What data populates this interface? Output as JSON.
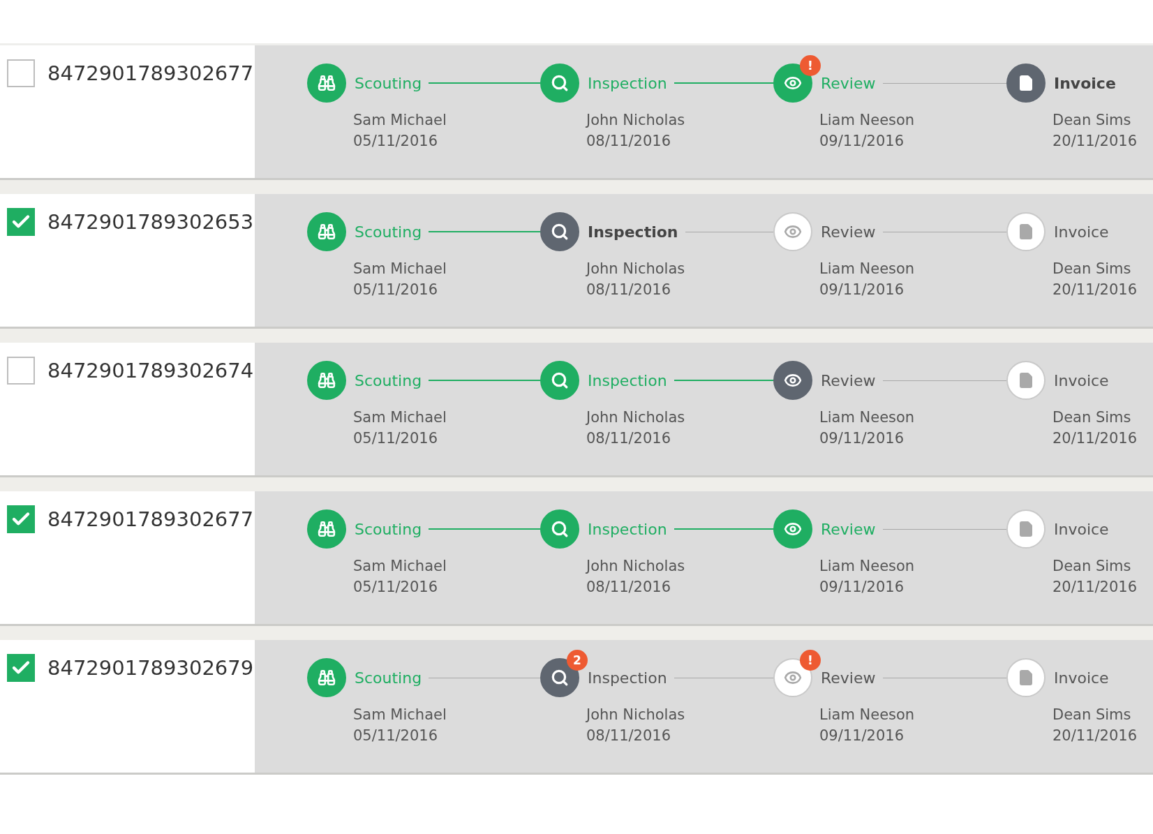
{
  "rows": [
    {
      "id": "8472901789302677",
      "checked": false,
      "stages": [
        {
          "kind": "scouting",
          "label": "Scouting",
          "done": true,
          "current": false,
          "line_done": true,
          "person": "Sam Michael",
          "date": "05/11/2016"
        },
        {
          "kind": "inspection",
          "label": "Inspection",
          "done": true,
          "current": false,
          "line_done": true,
          "person": "John Nicholas",
          "date": "08/11/2016"
        },
        {
          "kind": "review",
          "label": "Review",
          "done": true,
          "current": false,
          "badge": "!",
          "line_done": false,
          "person": "Liam Neeson",
          "date": "09/11/2016"
        },
        {
          "kind": "invoice",
          "label": "Invoice",
          "done": false,
          "reached": true,
          "current": true,
          "person": "Dean Sims",
          "date": "20/11/2016"
        }
      ]
    },
    {
      "id": "8472901789302653",
      "checked": true,
      "stages": [
        {
          "kind": "scouting",
          "label": "Scouting",
          "done": true,
          "current": false,
          "line_done": true,
          "person": "Sam Michael",
          "date": "05/11/2016"
        },
        {
          "kind": "inspection",
          "label": "Inspection",
          "done": false,
          "reached": true,
          "current": true,
          "line_done": false,
          "person": "John Nicholas",
          "date": "08/11/2016"
        },
        {
          "kind": "review",
          "label": "Review",
          "done": false,
          "reached": false,
          "current": false,
          "line_done": false,
          "person": "Liam Neeson",
          "date": "09/11/2016"
        },
        {
          "kind": "invoice",
          "label": "Invoice",
          "done": false,
          "reached": false,
          "current": false,
          "person": "Dean Sims",
          "date": "20/11/2016"
        }
      ]
    },
    {
      "id": "8472901789302674",
      "checked": false,
      "stages": [
        {
          "kind": "scouting",
          "label": "Scouting",
          "done": true,
          "current": false,
          "line_done": true,
          "person": "Sam Michael",
          "date": "05/11/2016"
        },
        {
          "kind": "inspection",
          "label": "Inspection",
          "done": true,
          "current": false,
          "line_done": true,
          "person": "John Nicholas",
          "date": "08/11/2016"
        },
        {
          "kind": "review",
          "label": "Review",
          "done": false,
          "reached": true,
          "current": false,
          "line_done": false,
          "person": "Liam Neeson",
          "date": "09/11/2016"
        },
        {
          "kind": "invoice",
          "label": "Invoice",
          "done": false,
          "reached": false,
          "current": false,
          "person": "Dean Sims",
          "date": "20/11/2016"
        }
      ]
    },
    {
      "id": "8472901789302677",
      "checked": true,
      "stages": [
        {
          "kind": "scouting",
          "label": "Scouting",
          "done": true,
          "current": false,
          "line_done": true,
          "person": "Sam Michael",
          "date": "05/11/2016"
        },
        {
          "kind": "inspection",
          "label": "Inspection",
          "done": true,
          "current": false,
          "line_done": true,
          "person": "John Nicholas",
          "date": "08/11/2016"
        },
        {
          "kind": "review",
          "label": "Review",
          "done": true,
          "current": false,
          "line_done": false,
          "person": "Liam Neeson",
          "date": "09/11/2016"
        },
        {
          "kind": "invoice",
          "label": "Invoice",
          "done": false,
          "reached": false,
          "current": false,
          "person": "Dean Sims",
          "date": "20/11/2016"
        }
      ]
    },
    {
      "id": "8472901789302679",
      "checked": true,
      "stages": [
        {
          "kind": "scouting",
          "label": "Scouting",
          "done": true,
          "current": false,
          "line_done": false,
          "person": "Sam Michael",
          "date": "05/11/2016"
        },
        {
          "kind": "inspection",
          "label": "Inspection",
          "done": false,
          "reached": true,
          "current": false,
          "badge": "2",
          "line_done": false,
          "person": "John Nicholas",
          "date": "08/11/2016"
        },
        {
          "kind": "review",
          "label": "Review",
          "done": false,
          "reached": false,
          "current": false,
          "badge": "!",
          "line_done": false,
          "person": "Liam Neeson",
          "date": "09/11/2016"
        },
        {
          "kind": "invoice",
          "label": "Invoice",
          "done": false,
          "reached": false,
          "current": false,
          "person": "Dean Sims",
          "date": "20/11/2016"
        }
      ]
    }
  ]
}
